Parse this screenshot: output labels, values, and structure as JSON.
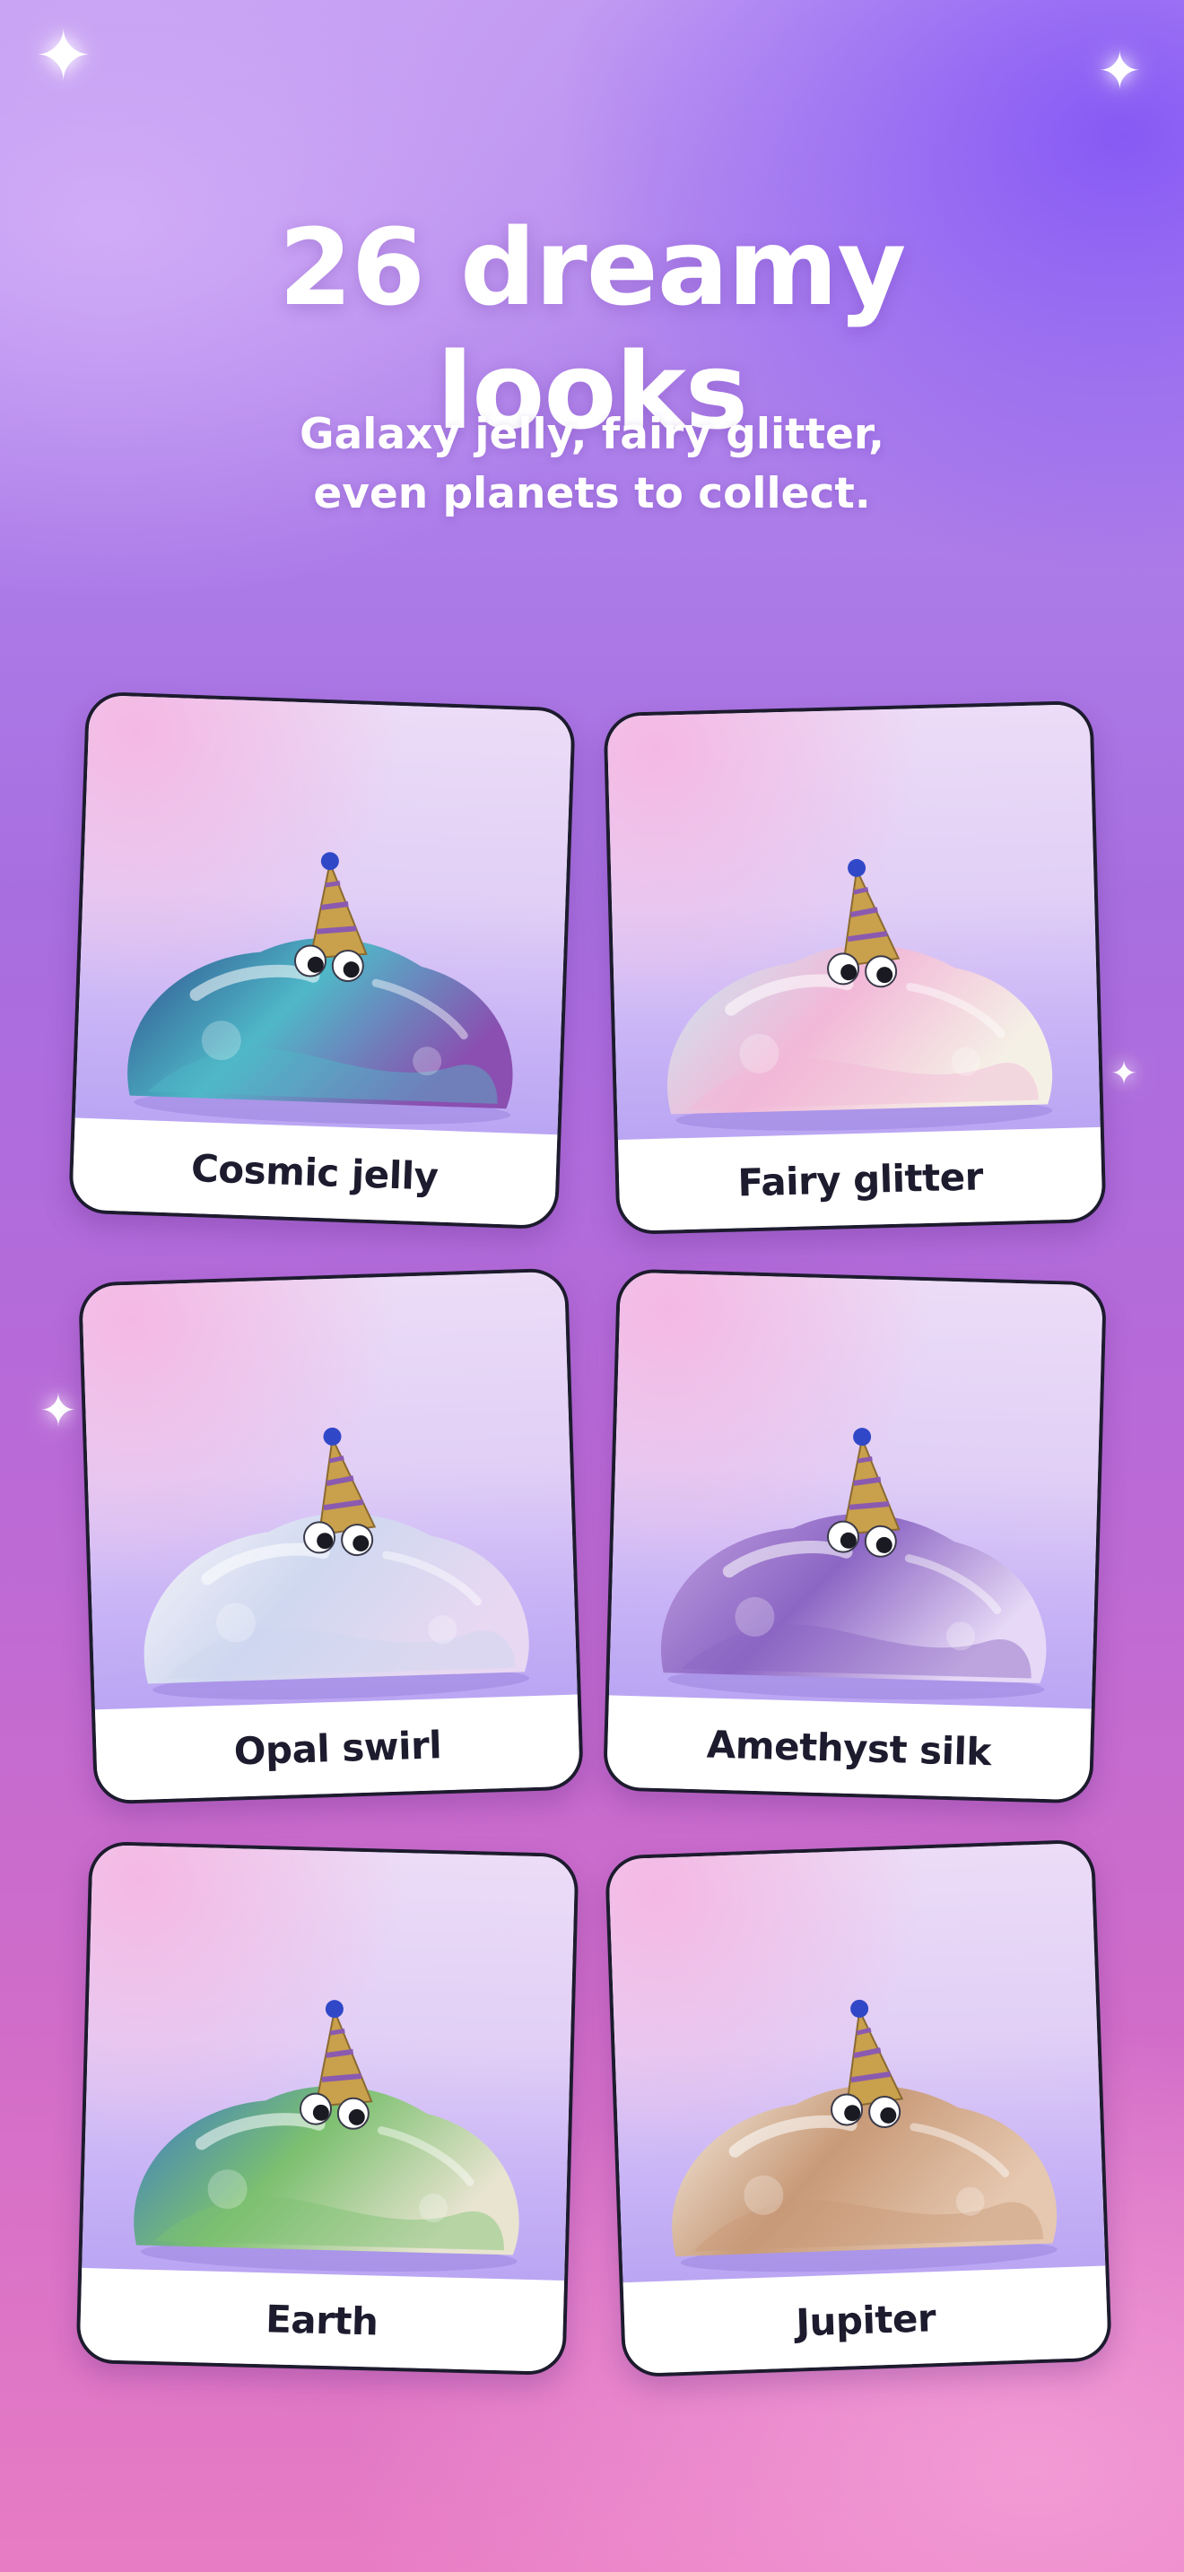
{
  "header": {
    "title_line1": "26 dreamy",
    "title_line2": "looks",
    "subtitle_line1": "Galaxy jelly, fairy glitter,",
    "subtitle_line2": "even planets to collect."
  },
  "sparkle_glyph": "✦",
  "looks": [
    {
      "label": "Cosmic jelly",
      "colors": [
        "#2e4c8a",
        "#4fb8c8",
        "#8a4fb0"
      ]
    },
    {
      "label": "Fairy glitter",
      "colors": [
        "#c9e8f2",
        "#f2b8d8",
        "#f5f0e6"
      ]
    },
    {
      "label": "Opal swirl",
      "colors": [
        "#f6f4f8",
        "#cfd8f0",
        "#e8d8f2"
      ]
    },
    {
      "label": "Amethyst silk",
      "colors": [
        "#c0a0e0",
        "#8c66c4",
        "#e6d8f6"
      ]
    },
    {
      "label": "Earth",
      "colors": [
        "#3a7ac8",
        "#7cc070",
        "#e8e4d0"
      ]
    },
    {
      "label": "Jupiter",
      "colors": [
        "#f4ece0",
        "#c89a78",
        "#e6c8b0"
      ]
    }
  ]
}
